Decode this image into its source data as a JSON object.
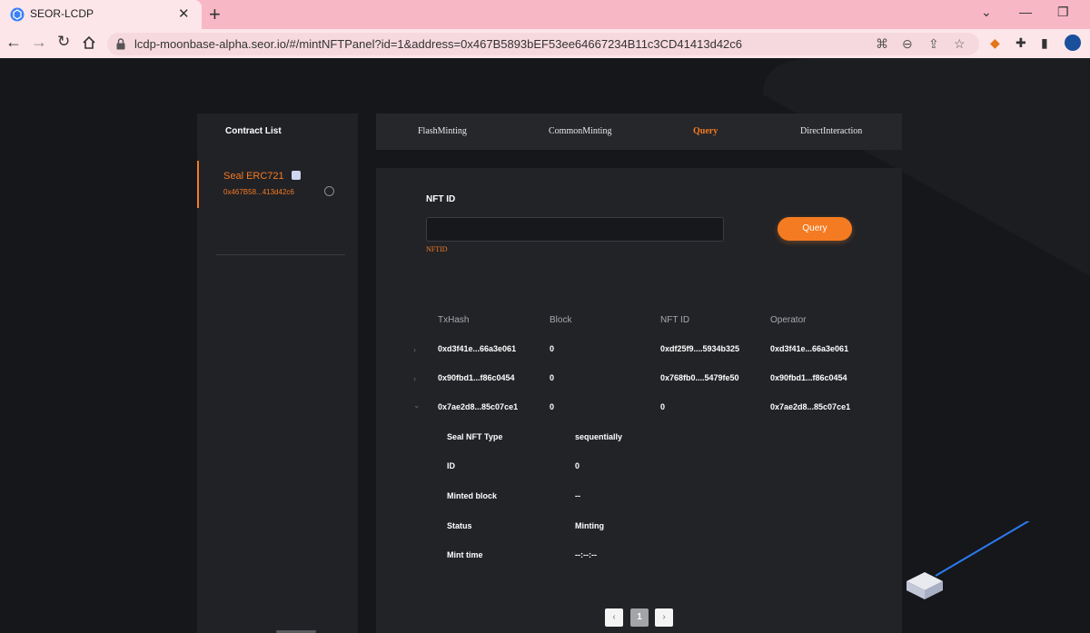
{
  "browser": {
    "tab_title": "SEOR-LCDP",
    "url": "lcdp-moonbase-alpha.seor.io/#/mintNFTPanel?id=1&address=0x467B5893bEF53ee64667234B11c3CD41413d42c6"
  },
  "sidebar": {
    "title": "Contract List",
    "contracts": [
      {
        "name": "Seal ERC721",
        "address": "0x467B58...413d42c6"
      }
    ]
  },
  "tabs": [
    {
      "label": "FlashMinting"
    },
    {
      "label": "CommonMinting"
    },
    {
      "label": "Query"
    },
    {
      "label": "DirectInteraction"
    }
  ],
  "query": {
    "field_label": "NFT ID",
    "input_value": "",
    "hint": "NFTID",
    "button_label": "Query"
  },
  "table": {
    "headers": [
      "TxHash",
      "Block",
      "NFT ID",
      "Operator"
    ],
    "rows": [
      {
        "caret": "›",
        "txhash": "0xd3f41e...66a3e061",
        "block": "0",
        "nft_id": "0xdf25f9....5934b325",
        "operator": "0xd3f41e...66a3e061"
      },
      {
        "caret": "›",
        "txhash": "0x90fbd1...f86c0454",
        "block": "0",
        "nft_id": "0x768fb0....5479fe50",
        "operator": "0x90fbd1...f86c0454"
      },
      {
        "caret": "⌄",
        "txhash": "0x7ae2d8...85c07ce1",
        "block": "0",
        "nft_id": "0",
        "operator": "0x7ae2d8...85c07ce1"
      }
    ],
    "details": [
      {
        "label": "Seal NFT Type",
        "value": "sequentially"
      },
      {
        "label": "ID",
        "value": "0"
      },
      {
        "label": "Minted block",
        "value": "--"
      },
      {
        "label": "Status",
        "value": "Minting"
      },
      {
        "label": "Mint time",
        "value": "--:--:--"
      }
    ]
  },
  "pagination": {
    "prev": "‹",
    "current": "1",
    "next": "›"
  },
  "colors": {
    "accent": "#f47b21",
    "page_bg": "#16171b",
    "panel_bg": "#222327"
  }
}
